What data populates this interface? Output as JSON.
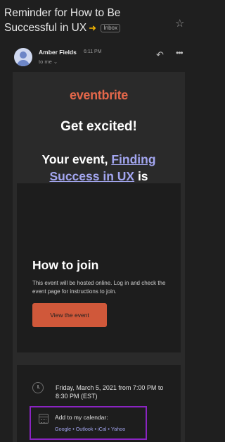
{
  "subject": {
    "title": "Reminder for How to Be Successful in UX",
    "badge": "Inbox"
  },
  "message": {
    "sender": "Amber Fields",
    "time": "6:11 PM",
    "recipient": "to me ⌄"
  },
  "email": {
    "logo": "eventbrite",
    "headline": "Get excited!",
    "event_prefix": "Your event, ",
    "event_link": "Finding Success in UX",
    "event_suffix": " is happening soon.",
    "join_title": "How to join",
    "join_description": "This event will be hosted online. Log in and check the event page for instructions to join.",
    "view_button": "View the event",
    "datetime": "Friday, March 5, 2021 from 7:00 PM to 8:30 PM (EST)",
    "calendar_label": "Add to my calendar:",
    "calendar_links": [
      "Google",
      "Outlook",
      "iCal",
      "Yahoo"
    ]
  },
  "icons": {
    "important": "important-marker-icon",
    "star": "star-icon",
    "reply": "reply-icon",
    "more": "more-icon",
    "clock": "clock-icon",
    "calendar": "calendar-icon"
  },
  "colors": {
    "brand": "#e4674a",
    "button": "#d0583a",
    "link": "#a3a6f0",
    "highlight": "#8a24c2"
  }
}
